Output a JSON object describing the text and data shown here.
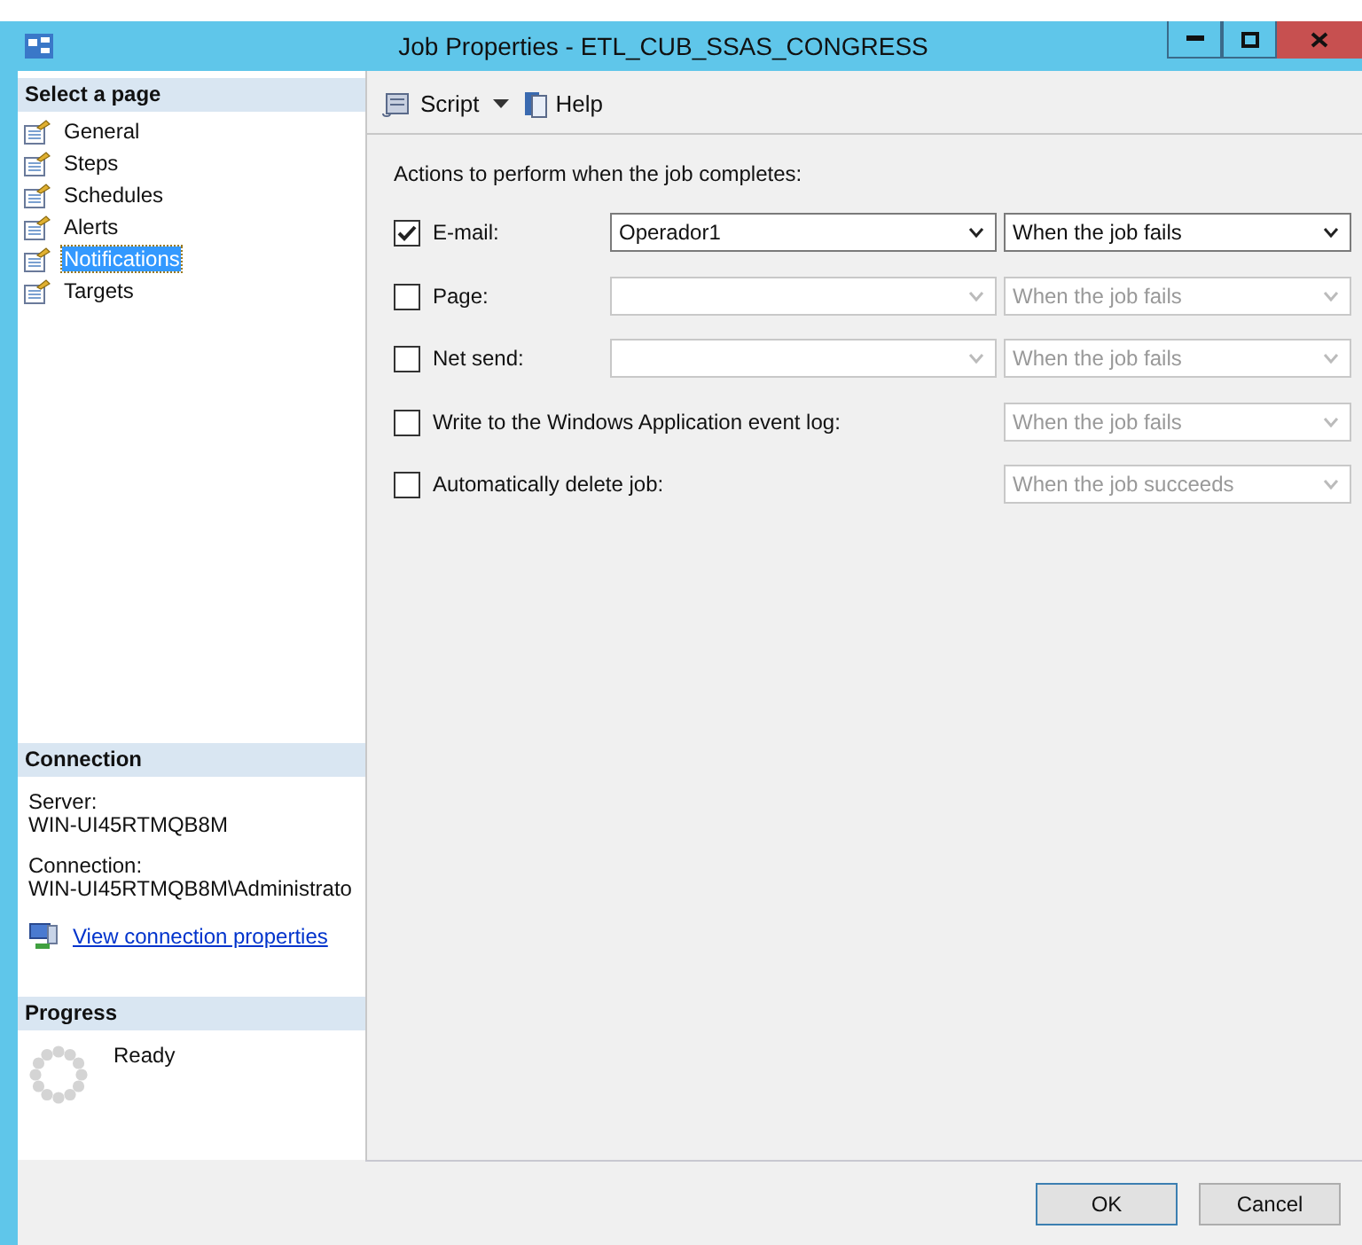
{
  "window": {
    "title": "Job Properties - ETL_CUB_SSAS_CONGRESS"
  },
  "sidebar": {
    "heading": "Select a page",
    "items": [
      {
        "label": "General",
        "selected": false
      },
      {
        "label": "Steps",
        "selected": false
      },
      {
        "label": "Schedules",
        "selected": false
      },
      {
        "label": "Alerts",
        "selected": false
      },
      {
        "label": "Notifications",
        "selected": true
      },
      {
        "label": "Targets",
        "selected": false
      }
    ]
  },
  "connection": {
    "heading": "Connection",
    "server_label": "Server:",
    "server": "WIN-UI45RTMQB8M",
    "connection_label": "Connection:",
    "connection": "WIN-UI45RTMQB8M\\Administrato",
    "link": "View connection properties"
  },
  "progress": {
    "heading": "Progress",
    "status": "Ready"
  },
  "toolbar": {
    "script": "Script",
    "help": "Help"
  },
  "intro": "Actions to perform when the job completes:",
  "actions": [
    {
      "kind": "operator",
      "label": "E-mail:",
      "checked": true,
      "operator": "Operador1",
      "when": "When the job fails"
    },
    {
      "kind": "operator",
      "label": "Page:",
      "checked": false,
      "when": "When the job fails"
    },
    {
      "kind": "operator",
      "label": "Net send:",
      "checked": false,
      "when": "When the job fails"
    },
    {
      "kind": "simple",
      "label": "Write to the Windows Application event log:",
      "checked": false,
      "when": "When the job fails"
    },
    {
      "kind": "simple",
      "label": "Automatically delete job:",
      "checked": false,
      "when": "When the job succeeds"
    }
  ],
  "buttons": [
    "OK",
    "Cancel"
  ]
}
